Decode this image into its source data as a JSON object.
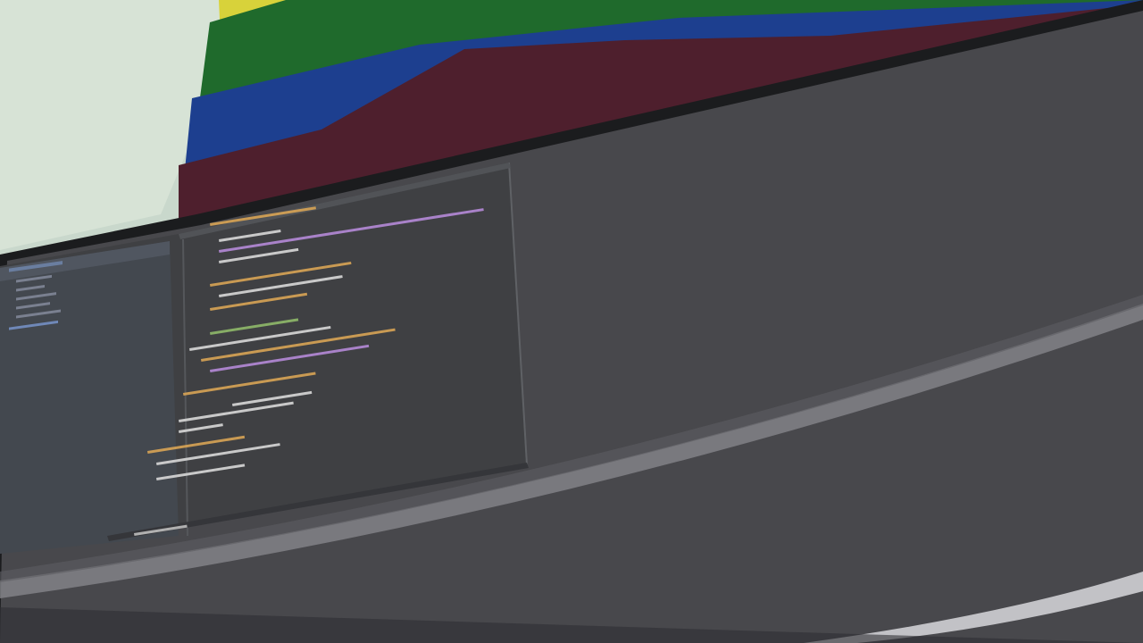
{
  "photo": {
    "subject": "photograph-of-monitor-with-code-editor",
    "colors": {
      "wall": "#c9d8cc",
      "poster_yellow": "#d8d23a",
      "poster_green": "#1f6a2c",
      "poster_blue": "#1d3f8f",
      "poster_maroon": "#4e1f2d",
      "bezel": "#1b1c1e",
      "screen": "#48484c",
      "editor_bg": "#3f4043",
      "sidebar_bg": "#43484f",
      "code_orange": "#d9a455",
      "code_purple": "#b58ad8",
      "code_white": "#d8d8d8",
      "code_green": "#8fb96a",
      "reflection": "#8a8a8f"
    },
    "editor": {
      "status_bar_text": "",
      "tabs": []
    }
  }
}
